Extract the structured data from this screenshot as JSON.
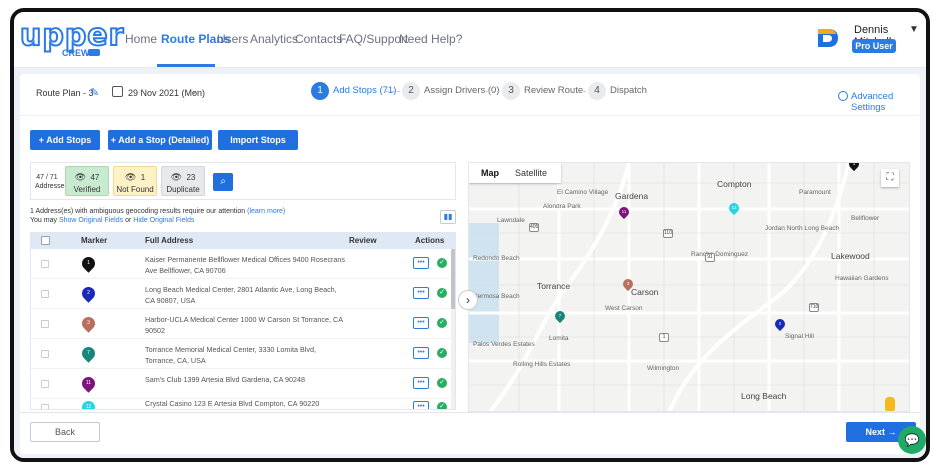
{
  "brand": {
    "logo_text": "upper",
    "logo_sub": "CREW"
  },
  "nav": {
    "items": [
      "Home",
      "Route Plans",
      "Users",
      "Analytics",
      "Contacts",
      "FAQ/Support",
      "Need Help?"
    ],
    "active": "Route Plans"
  },
  "user": {
    "name": "Dennis Mitchell",
    "badge": "Pro User"
  },
  "plan": {
    "name": "Route Plan - 3",
    "date": "29 Nov 2021 (Mon)"
  },
  "steps": [
    {
      "num": "1",
      "label": "Add Stops (71)"
    },
    {
      "num": "2",
      "label": "Assign Drivers (0)"
    },
    {
      "num": "3",
      "label": "Review Route"
    },
    {
      "num": "4",
      "label": "Dispatch"
    }
  ],
  "advanced_settings": "Advanced Settings",
  "buttons": {
    "add_stops": "+  Add Stops",
    "add_stop_detailed": "+  Add a Stop (Detailed)",
    "import_stops": "Import Stops"
  },
  "stats": {
    "addresses_count": "47 / 71",
    "addresses_label": "Addresses",
    "verified_count": "47",
    "verified_label": "Verified",
    "notfound_count": "1",
    "notfound_label": "Not Found",
    "duplicate_count": "23",
    "duplicate_label": "Duplicate"
  },
  "warning": {
    "line1": "1 Address(es) with ambiguous geocoding results require our attention",
    "learn_more": "(learn more)",
    "line2_prefix": "You may",
    "show_fields": "Show Original Fields",
    "or": "or",
    "hide_fields": "Hide Original Fields"
  },
  "table": {
    "headers": {
      "marker": "Marker",
      "address": "Full Address",
      "review": "Review",
      "actions": "Actions"
    },
    "rows": [
      {
        "num": "1",
        "color": "#111111",
        "address": "Kaiser Permanente Bellflower Medical Offices 9400 Rosecrans Ave Bellflower, CA 90706"
      },
      {
        "num": "2",
        "color": "#1a2ab5",
        "address": "Long Beach Medical Center, 2801 Atlantic Ave, Long Beach, CA 90807, USA"
      },
      {
        "num": "3",
        "color": "#b86f5e",
        "address": "Harbor-UCLA Medical Center 1000 W Carson St Torrance, CA 90502"
      },
      {
        "num": "7",
        "color": "#17877a",
        "address": "Torrance Memorial Medical Center, 3330 Lomita Blvd, Torrance, CA, USA"
      },
      {
        "num": "11",
        "color": "#7d137d",
        "address": "Sam's Club 1399 Artesia Blvd Gardena, CA 90248"
      },
      {
        "num": "12",
        "color": "#22d6e6",
        "address": "Crystal Casino 123 E Artesia Blvd Compton, CA 90220"
      }
    ],
    "more_symbol": "•••",
    "ok_symbol": "✓"
  },
  "map": {
    "tabs": [
      "Map",
      "Satellite"
    ],
    "labels": [
      "Compton",
      "Paramount",
      "Gardena",
      "El Camino Village",
      "Alondra Park",
      "Lawndale",
      "Redondo Beach",
      "Torrance",
      "Carson",
      "West Carson",
      "Lakewood",
      "Hawaiian Gardens",
      "Signal Hill",
      "Long Beach",
      "Rolling Hills Estates",
      "Palos Verdes Estates",
      "Lomita",
      "Wilmington",
      "Rancho Dominguez",
      "Bellflower",
      "Jordan North Long Beach",
      "Hermosa Beach"
    ]
  },
  "footer": {
    "back": "Back",
    "next": "Next  →"
  }
}
